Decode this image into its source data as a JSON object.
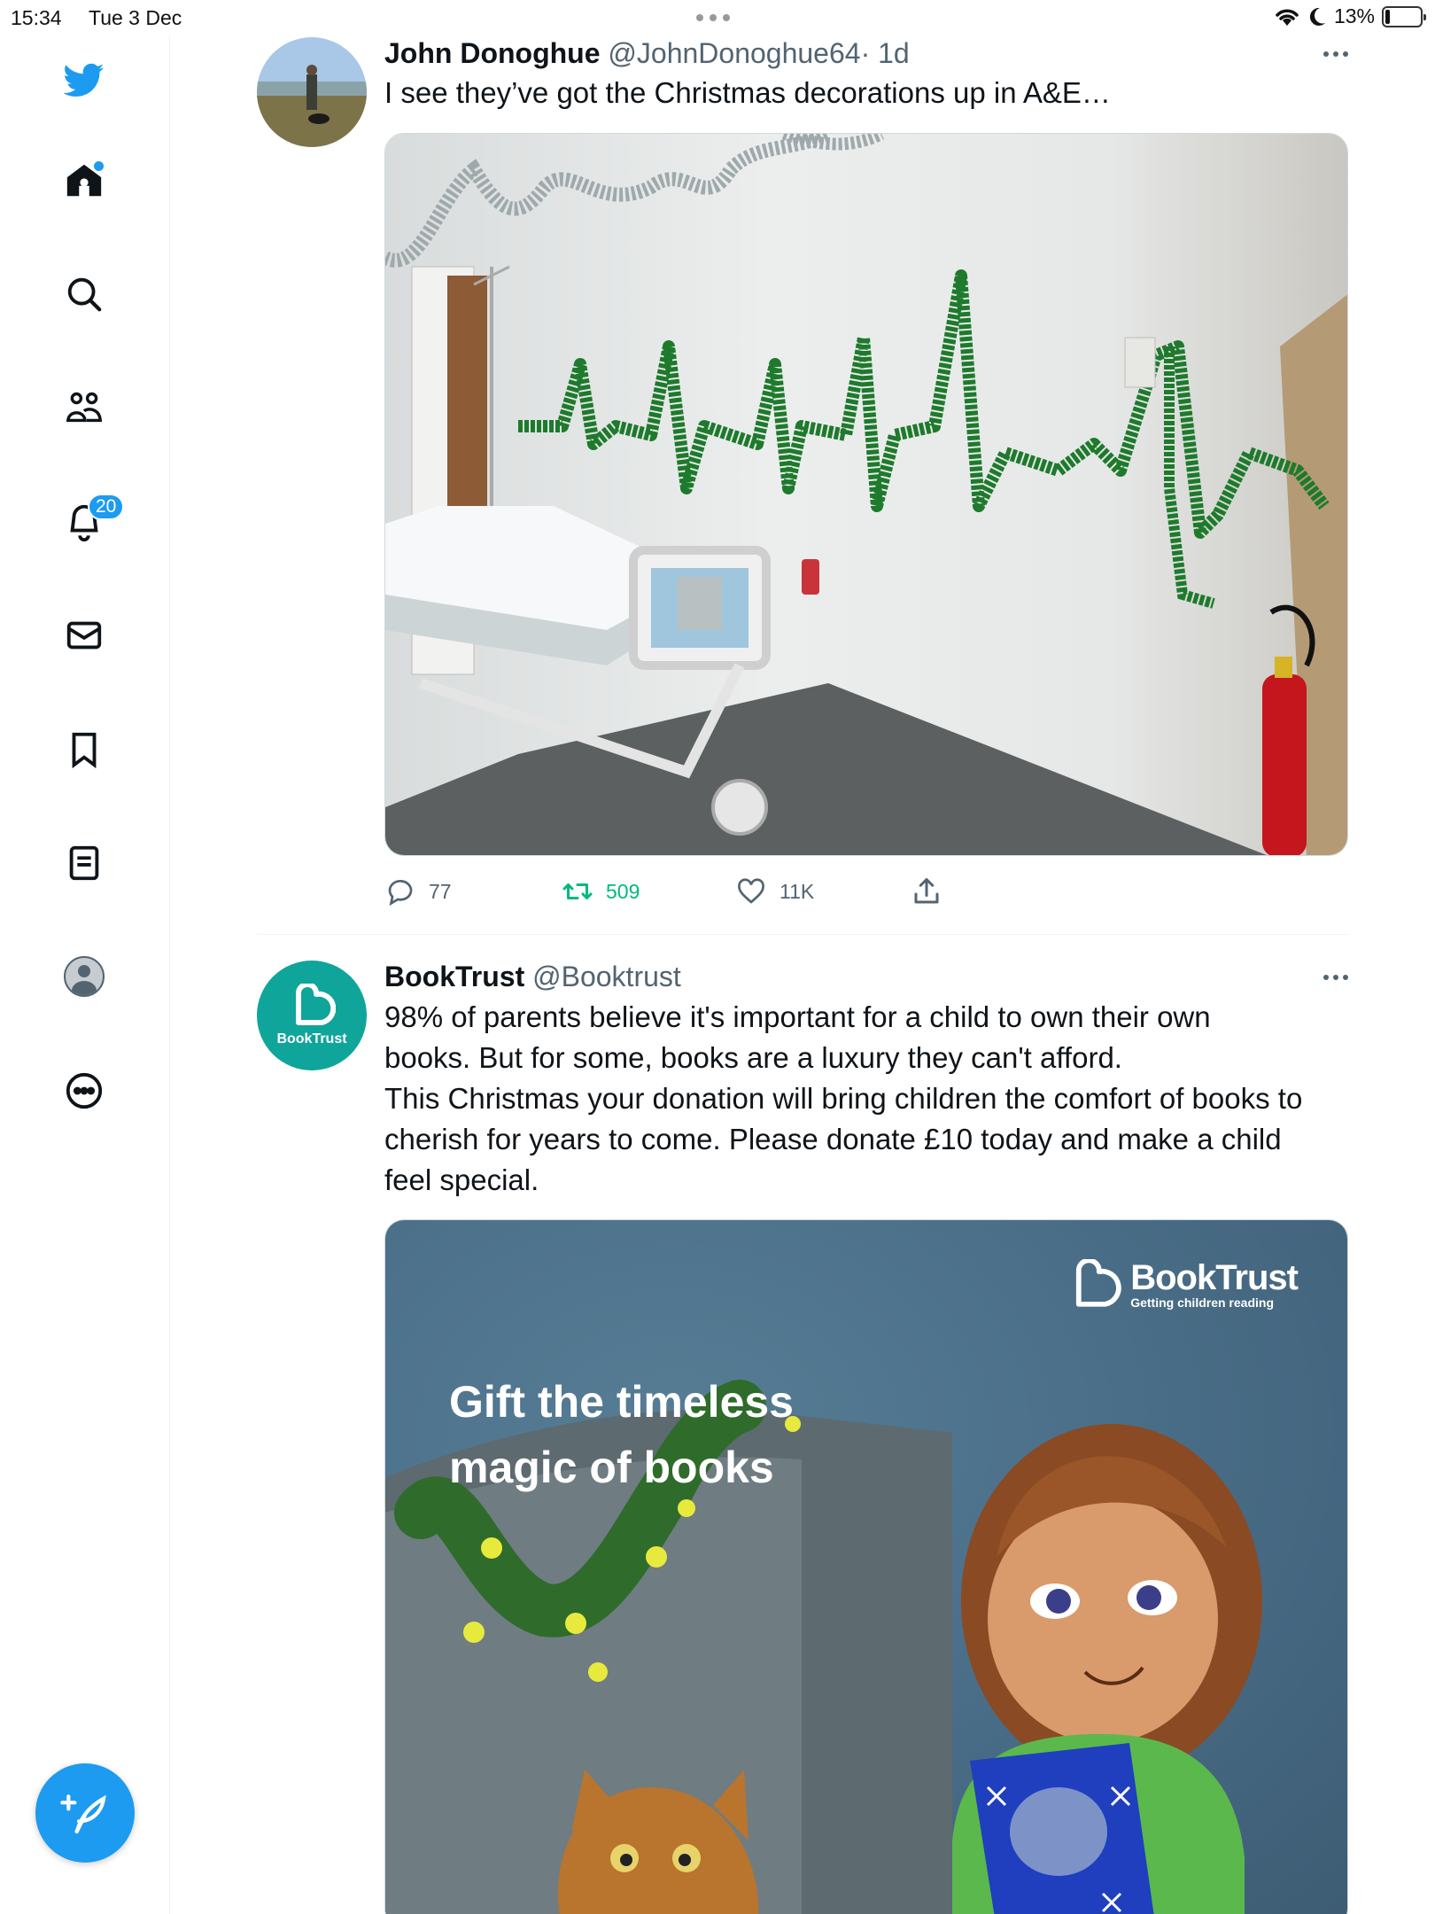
{
  "status_bar": {
    "time": "15:34",
    "date": "Tue 3 Dec",
    "battery": "13%",
    "battery_level": 0.13
  },
  "sidebar": {
    "notifications_badge": "20",
    "icons": [
      "twitter-logo-icon",
      "home-icon",
      "search-icon",
      "communities-icon",
      "notifications-icon",
      "messages-icon",
      "bookmarks-icon",
      "lists-icon",
      "profile-icon",
      "more-icon"
    ],
    "accent_color": "#1d9bf0"
  },
  "tweets": [
    {
      "name": "John Donoghue",
      "handle": "@JohnDonoghue64",
      "time": "· 1d",
      "text": "I see they’ve got the Christmas decorations up in A&E…",
      "stats": {
        "replies": "77",
        "retweets": "509",
        "likes": "11K"
      }
    },
    {
      "name": "BookTrust",
      "handle": "@Booktrust",
      "avatar_label": "BookTrust",
      "text_lines": [
        "98% of parents believe it's important for a child to own their own",
        "books. But for some, books are a luxury they can't afford.",
        "This Christmas your donation will bring children the comfort of books to",
        "cherish for years to come. Please donate £10 today and make a child",
        "feel special."
      ],
      "ad": {
        "brand": "BookTrust",
        "tagline": "Getting children reading",
        "headline_line1": "Gift the timeless",
        "headline_line2": "magic of books"
      }
    }
  ],
  "colors": {
    "retweet_green": "#00ba7c",
    "secondary_text": "#536471",
    "booktrust_teal": "#0fa59a"
  }
}
